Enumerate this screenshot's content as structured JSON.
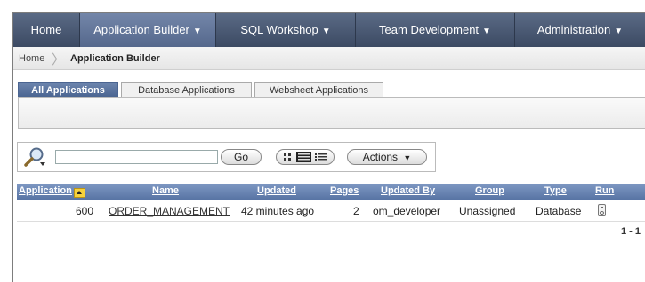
{
  "nav": {
    "tabs": [
      {
        "label": "Home",
        "caret": ""
      },
      {
        "label": "Application Builder",
        "caret": "▼"
      },
      {
        "label": "SQL Workshop",
        "caret": "▼"
      },
      {
        "label": "Team Development",
        "caret": "▼"
      },
      {
        "label": "Administration",
        "caret": "▼"
      }
    ],
    "active_index": 1
  },
  "breadcrumb": {
    "home": "Home",
    "separator": "〉",
    "current": "Application Builder"
  },
  "subtabs": {
    "items": [
      "All Applications",
      "Database Applications",
      "Websheet Applications"
    ],
    "active_index": 0
  },
  "search": {
    "icon": "magnifier-search-icon",
    "value": "",
    "go_label": "Go",
    "view_toggle_icons": [
      "icon-view-icon",
      "report-view-icon",
      "details-view-icon"
    ],
    "actions_label": "Actions"
  },
  "report": {
    "columns": {
      "application": "Application",
      "name": "Name",
      "updated": "Updated",
      "pages": "Pages",
      "updated_by": "Updated By",
      "group": "Group",
      "type": "Type",
      "run": "Run"
    },
    "rows": [
      {
        "application": "600",
        "name": "ORDER_MANAGEMENT",
        "updated": "42 minutes ago",
        "pages": "2",
        "updated_by": "om_developer",
        "group": "Unassigned",
        "type": "Database",
        "run_icon": "run-application-icon"
      }
    ],
    "pagination": "1 - 1"
  },
  "colors": {
    "nav_bg": "#3c4a63",
    "nav_active": "#55688c",
    "header_bg": "#5874a4",
    "link": "#1f3f7f"
  }
}
